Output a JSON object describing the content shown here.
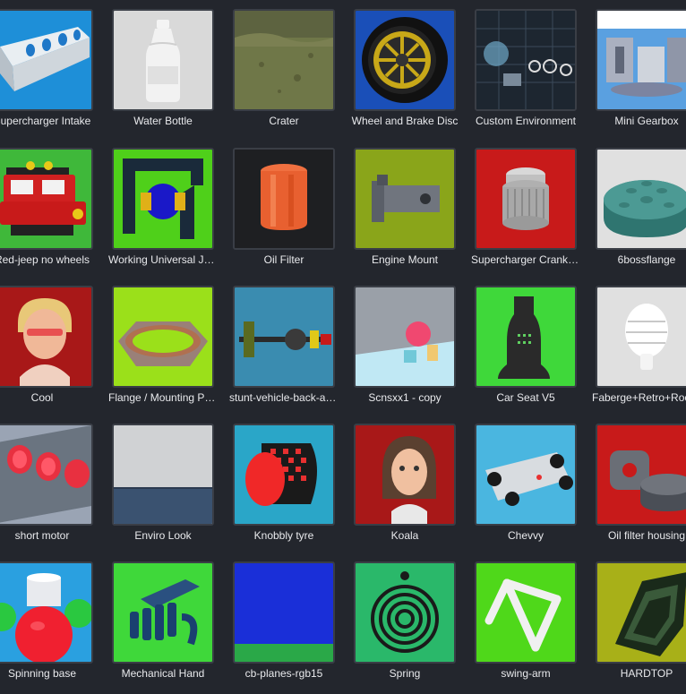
{
  "gallery": {
    "items": [
      {
        "label": "Supercharger Intake",
        "icon": "supercharger-intake-model",
        "bg": "#1e8fd8"
      },
      {
        "label": "Water Bottle",
        "icon": "water-bottle-model",
        "bg": "#d9d9d9"
      },
      {
        "label": "Crater",
        "icon": "crater-terrain-model",
        "bg": "#6f7748"
      },
      {
        "label": "Wheel and Brake Disc",
        "icon": "wheel-model",
        "bg": "#1a4fb8"
      },
      {
        "label": "Custom Environment",
        "icon": "custom-environment-model",
        "bg": "#1d2630"
      },
      {
        "label": "Mini Gearbox",
        "icon": "mini-gearbox-model",
        "bg": "#5aa0e0"
      },
      {
        "label": "Red-jeep no wheels",
        "icon": "jeep-model",
        "bg": "#3fb83a"
      },
      {
        "label": "Working Universal Joint",
        "icon": "universal-joint-model",
        "bg": "#4fd01a"
      },
      {
        "label": "Oil Filter",
        "icon": "oil-filter-model",
        "bg": "#1e1f22"
      },
      {
        "label": "Engine Mount",
        "icon": "engine-mount-model",
        "bg": "#8aa51a"
      },
      {
        "label": "Supercharger Crankshaft",
        "icon": "supercharger-crank-model",
        "bg": "#c81a1a"
      },
      {
        "label": "6bossflange",
        "icon": "boss-flange-model",
        "bg": "#e0e0e0"
      },
      {
        "label": "Cool",
        "icon": "avatar-cool-model",
        "bg": "#a81818"
      },
      {
        "label": "Flange / Mounting Plate",
        "icon": "flange-plate-model",
        "bg": "#9be01a"
      },
      {
        "label": "stunt-vehicle-back-axle",
        "icon": "axle-model",
        "bg": "#3a8cb0"
      },
      {
        "label": "Scnsxx1 - copy",
        "icon": "scene-shapes-model",
        "bg": "#9aa0a8"
      },
      {
        "label": "Car Seat V5",
        "icon": "car-seat-model",
        "bg": "#3fd83a"
      },
      {
        "label": "Faberge+Retro+Rocket",
        "icon": "faberge-egg-model",
        "bg": "#e0e0e0"
      },
      {
        "label": "short motor",
        "icon": "engine-block-model",
        "bg": "#9aa4b4"
      },
      {
        "label": "Enviro Look",
        "icon": "enviro-look-model",
        "bg": "#d0d2d4"
      },
      {
        "label": "Knobbly tyre",
        "icon": "knobbly-tyre-model",
        "bg": "#2aa6c8"
      },
      {
        "label": "Koala",
        "icon": "avatar-koala-model",
        "bg": "#a81818"
      },
      {
        "label": "Chevvy",
        "icon": "chevvy-chassis-model",
        "bg": "#4ab6e0"
      },
      {
        "label": "Oil filter housing",
        "icon": "oil-filter-housing-model",
        "bg": "#c81a1a"
      },
      {
        "label": "Spinning base",
        "icon": "spinning-base-model",
        "bg": "#2aa0e0"
      },
      {
        "label": "Mechanical Hand",
        "icon": "mechanical-hand-model",
        "bg": "#3fd83a"
      },
      {
        "label": "cb-planes-rgb15",
        "icon": "planes-model",
        "bg": "#1a2fd8"
      },
      {
        "label": "Spring",
        "icon": "spring-model",
        "bg": "#2ab86a"
      },
      {
        "label": "swing-arm",
        "icon": "swing-arm-model",
        "bg": "#4fd81a"
      },
      {
        "label": "HARDTOP",
        "icon": "hardtop-model",
        "bg": "#a8b018"
      }
    ]
  }
}
